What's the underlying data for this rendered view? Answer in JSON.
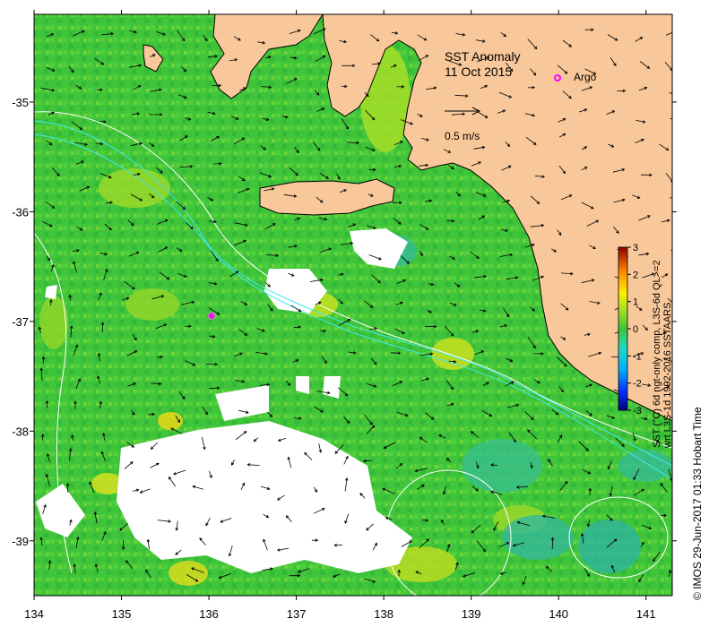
{
  "title": {
    "line1": "SST Anomaly",
    "line2": "11 Oct 2015"
  },
  "legend": {
    "argo_label": "Argo",
    "argo_color": "#ff00ff",
    "scale_label": "0.5 m/s"
  },
  "axes": {
    "x_ticks": [
      "134",
      "135",
      "136",
      "137",
      "138",
      "139",
      "140",
      "141"
    ],
    "y_ticks": [
      "-35",
      "-36",
      "-37",
      "-38",
      "-39"
    ]
  },
  "colorbar": {
    "ticks": [
      "3",
      "2",
      "1",
      "0",
      "-1",
      "-2",
      "-3"
    ],
    "caption_line1": "SST (°C) 6d ngt-only comp, L3S-6d QL>=2",
    "caption_line2": "wrt L3S-1d 1992-2016 SSTAARS",
    "range": [
      -3,
      3
    ]
  },
  "credit": "©  IMOS 29-Jun-2017 01:33 Hobart Time",
  "colors": {
    "land": "#f9c89a",
    "ocean_base": "#3fc43a",
    "no_data": "#ffffff",
    "contour": "#ffffff",
    "shelf_contour": "#3fe8e8"
  },
  "argo_float": {
    "lon": 136.03,
    "lat": -36.95
  }
}
